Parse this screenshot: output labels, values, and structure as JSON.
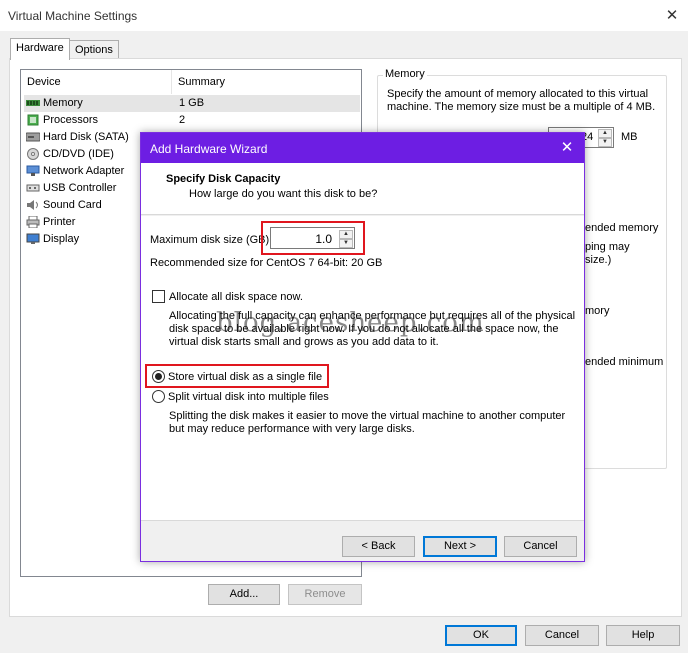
{
  "window": {
    "title": "Virtual Machine Settings",
    "close_glyph": "✕",
    "tabs": [
      {
        "label": "Hardware",
        "active": true
      },
      {
        "label": "Options",
        "active": false
      }
    ]
  },
  "device_list": {
    "headers": {
      "device": "Device",
      "summary": "Summary"
    },
    "rows": [
      {
        "name": "Memory",
        "summary": "1 GB",
        "icon": "memory-icon",
        "selected": true
      },
      {
        "name": "Processors",
        "summary": "2",
        "icon": "processor-icon"
      },
      {
        "name": "Hard Disk (SATA)",
        "summary": "",
        "icon": "hard-disk-icon"
      },
      {
        "name": "CD/DVD (IDE)",
        "summary": "",
        "icon": "cd-dvd-icon"
      },
      {
        "name": "Network Adapter",
        "summary": "",
        "icon": "network-adapter-icon"
      },
      {
        "name": "USB Controller",
        "summary": "",
        "icon": "usb-icon"
      },
      {
        "name": "Sound Card",
        "summary": "",
        "icon": "sound-card-icon"
      },
      {
        "name": "Printer",
        "summary": "",
        "icon": "printer-icon"
      },
      {
        "name": "Display",
        "summary": "",
        "icon": "display-icon"
      }
    ],
    "add_label": "Add...",
    "remove_label": "Remove"
  },
  "memory_panel": {
    "title": "Memory",
    "desc_line1": "Specify the amount of memory allocated to this virtual",
    "desc_line2": "machine. The memory size must be a multiple of 4 MB.",
    "value_fragment": "24",
    "unit": "MB",
    "partial_text_1": "ended memory",
    "partial_text_2": "ping may",
    "partial_text_3": "size.)",
    "partial_text_4": "mory",
    "partial_text_5": "ended minimum"
  },
  "footer": {
    "ok_label": "OK",
    "cancel_label": "Cancel",
    "help_label": "Help"
  },
  "wizard": {
    "title": "Add Hardware Wizard",
    "close_glyph": "✕",
    "header_title": "Specify Disk Capacity",
    "header_subtitle": "How large do you want this disk to be?",
    "max_size_label": "Maximum disk size (GB):",
    "max_size_value": "1.0",
    "recommended": "Recommended size for CentOS 7 64-bit: 20 GB",
    "allocate_label": "Allocate all disk space now.",
    "allocate_checked": false,
    "allocate_desc_1": "Allocating the full capacity can enhance performance but requires all of the physical",
    "allocate_desc_2": "disk space to be available right now. If you do not allocate all the space now, the",
    "allocate_desc_3": "virtual disk starts small and grows as you add data to it.",
    "single_file_label": "Store virtual disk as a single file",
    "multi_file_label": "Split virtual disk into multiple files",
    "multi_desc_1": "Splitting the disk makes it easier to move the virtual machine to another computer",
    "multi_desc_2": "but may reduce performance with very large disks.",
    "selected_option": "single",
    "back_label": "< Back",
    "next_label": "Next >",
    "cancel_label": "Cancel",
    "highlight_color": "#e0161e",
    "accent_color": "#6d1ee3"
  },
  "watermark": "blog.acesheep.com"
}
